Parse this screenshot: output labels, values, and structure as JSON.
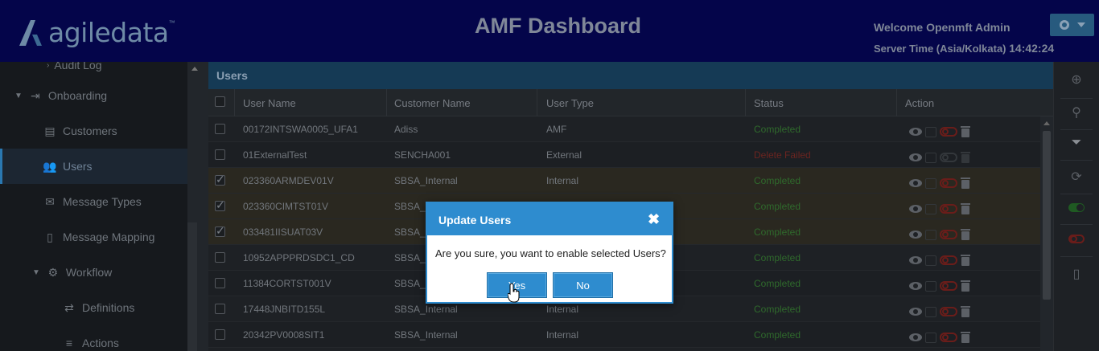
{
  "header": {
    "logo_text": "agiledata",
    "logo_tm": "™",
    "title": "AMF Dashboard",
    "welcome": "Welcome Openmft Admin",
    "server_time_label": "Server Time (Asia/Kolkata)",
    "server_time_value": "14:42:24",
    "colors": {
      "background": "#04054a",
      "accent": "#2e8ccf"
    }
  },
  "sidebar": {
    "items": [
      {
        "label": "Audit Log",
        "icon": "chevron-right-icon"
      },
      {
        "label": "Onboarding",
        "icon": "sign-in-icon"
      },
      {
        "label": "Customers",
        "icon": "id-card-icon"
      },
      {
        "label": "Users",
        "icon": "users-icon"
      },
      {
        "label": "Message Types",
        "icon": "envelope-icon"
      },
      {
        "label": "Message Mapping",
        "icon": "code-file-icon"
      },
      {
        "label": "Workflow",
        "icon": "gear-icon"
      },
      {
        "label": "Definitions",
        "icon": "exchange-icon"
      },
      {
        "label": "Actions",
        "icon": "list-icon"
      }
    ]
  },
  "panel": {
    "title": "Users",
    "columns": [
      "User Name",
      "Customer Name",
      "User Type",
      "Status",
      "Action"
    ],
    "rows": [
      {
        "user": "00172INTSWA0005_UFA1",
        "customer": "Adiss",
        "type": "AMF",
        "status": "Completed",
        "checked": false
      },
      {
        "user": "01ExternalTest",
        "customer": "SENCHA001",
        "type": "External",
        "status": "Delete Failed",
        "checked": false
      },
      {
        "user": "023360ARMDEV01V",
        "customer": "SBSA_Internal",
        "type": "Internal",
        "status": "Completed",
        "checked": true
      },
      {
        "user": "023360CIMTST01V",
        "customer": "SBSA_I",
        "type": "",
        "status": "Completed",
        "checked": true
      },
      {
        "user": "033481IISUAT03V",
        "customer": "SBSA_I",
        "type": "",
        "status": "Completed",
        "checked": true
      },
      {
        "user": "10952APPPRDSDC1_CD",
        "customer": "SBSA_I",
        "type": "",
        "status": "Completed",
        "checked": false
      },
      {
        "user": "11384CORTST001V",
        "customer": "SBSA_I",
        "type": "",
        "status": "Completed",
        "checked": false
      },
      {
        "user": "17448JNBITD155L",
        "customer": "SBSA_Internal",
        "type": "Internal",
        "status": "Completed",
        "checked": false
      },
      {
        "user": "20342PV0008SIT1",
        "customer": "SBSA_Internal",
        "type": "Internal",
        "status": "Completed",
        "checked": false
      }
    ]
  },
  "toolbar": {
    "icons": [
      "plus-circle-icon",
      "search-icon",
      "filter-icon",
      "refresh-icon",
      "toggle-on-icon",
      "toggle-off-icon",
      "excel-icon"
    ]
  },
  "dialog": {
    "title": "Update Users",
    "close": "✖",
    "message": "Are you sure, you want to enable selected Users?",
    "yes_label": "Yes",
    "no_label": "No"
  }
}
